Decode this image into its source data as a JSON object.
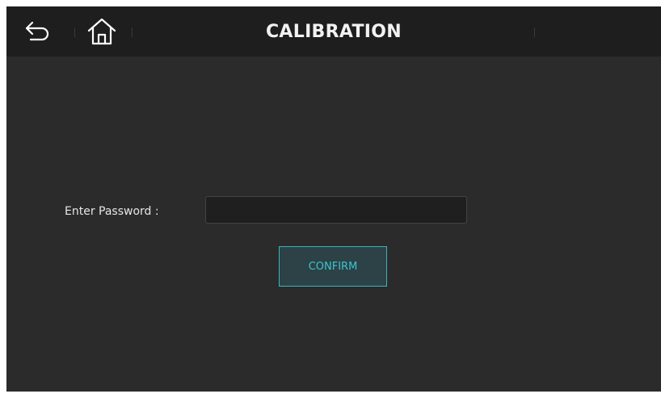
{
  "header": {
    "title": "CALIBRATION",
    "back_icon": "back-arrow-icon",
    "home_icon": "home-icon"
  },
  "form": {
    "password_label": "Enter Password :",
    "password_value": "",
    "password_placeholder": "",
    "confirm_label": "CONFIRM"
  },
  "colors": {
    "background": "#2b2b2b",
    "header": "#1e1e1e",
    "accent": "#3cc4cf"
  }
}
